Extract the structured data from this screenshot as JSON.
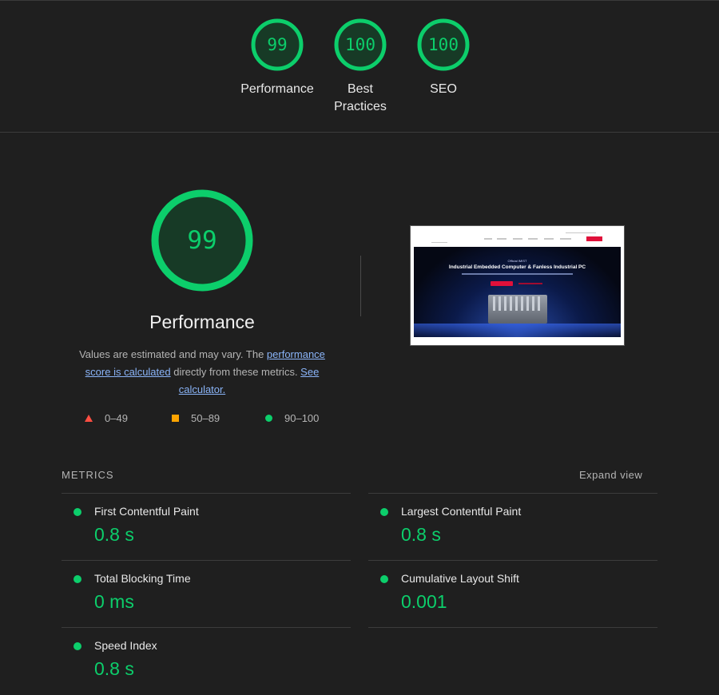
{
  "summary": {
    "gauges": [
      {
        "score": "99",
        "label": "Performance"
      },
      {
        "score": "100",
        "label": "Best Practices"
      },
      {
        "score": "100",
        "label": "SEO"
      }
    ]
  },
  "performance": {
    "score": "99",
    "title": "Performance",
    "desc_prefix": "Values are estimated and may vary. The ",
    "desc_link1": "performance score is calculated",
    "desc_middle": " directly from these metrics. ",
    "desc_link2": "See calculator.",
    "legend": [
      {
        "range": "0–49",
        "shape": "triangle",
        "color": "#ff4e42"
      },
      {
        "range": "50–89",
        "shape": "square",
        "color": "#ffa400"
      },
      {
        "range": "90–100",
        "shape": "circle",
        "color": "#0cce6b"
      }
    ]
  },
  "screenshot": {
    "hero_kicker": "Official IMIST",
    "hero_title": "Industrial Embedded Computer & Fanless Industrial PC"
  },
  "metrics": {
    "heading": "METRICS",
    "expand_label": "Expand view",
    "items": [
      {
        "title": "First Contentful Paint",
        "value": "0.8 s"
      },
      {
        "title": "Largest Contentful Paint",
        "value": "0.8 s"
      },
      {
        "title": "Total Blocking Time",
        "value": "0 ms"
      },
      {
        "title": "Cumulative Layout Shift",
        "value": "0.001"
      },
      {
        "title": "Speed Index",
        "value": "0.8 s"
      }
    ]
  },
  "colors": {
    "pass": "#0cce6b",
    "pass_fill": "#173a26",
    "link": "#8ab4f8",
    "background": "#1f1f1f"
  }
}
